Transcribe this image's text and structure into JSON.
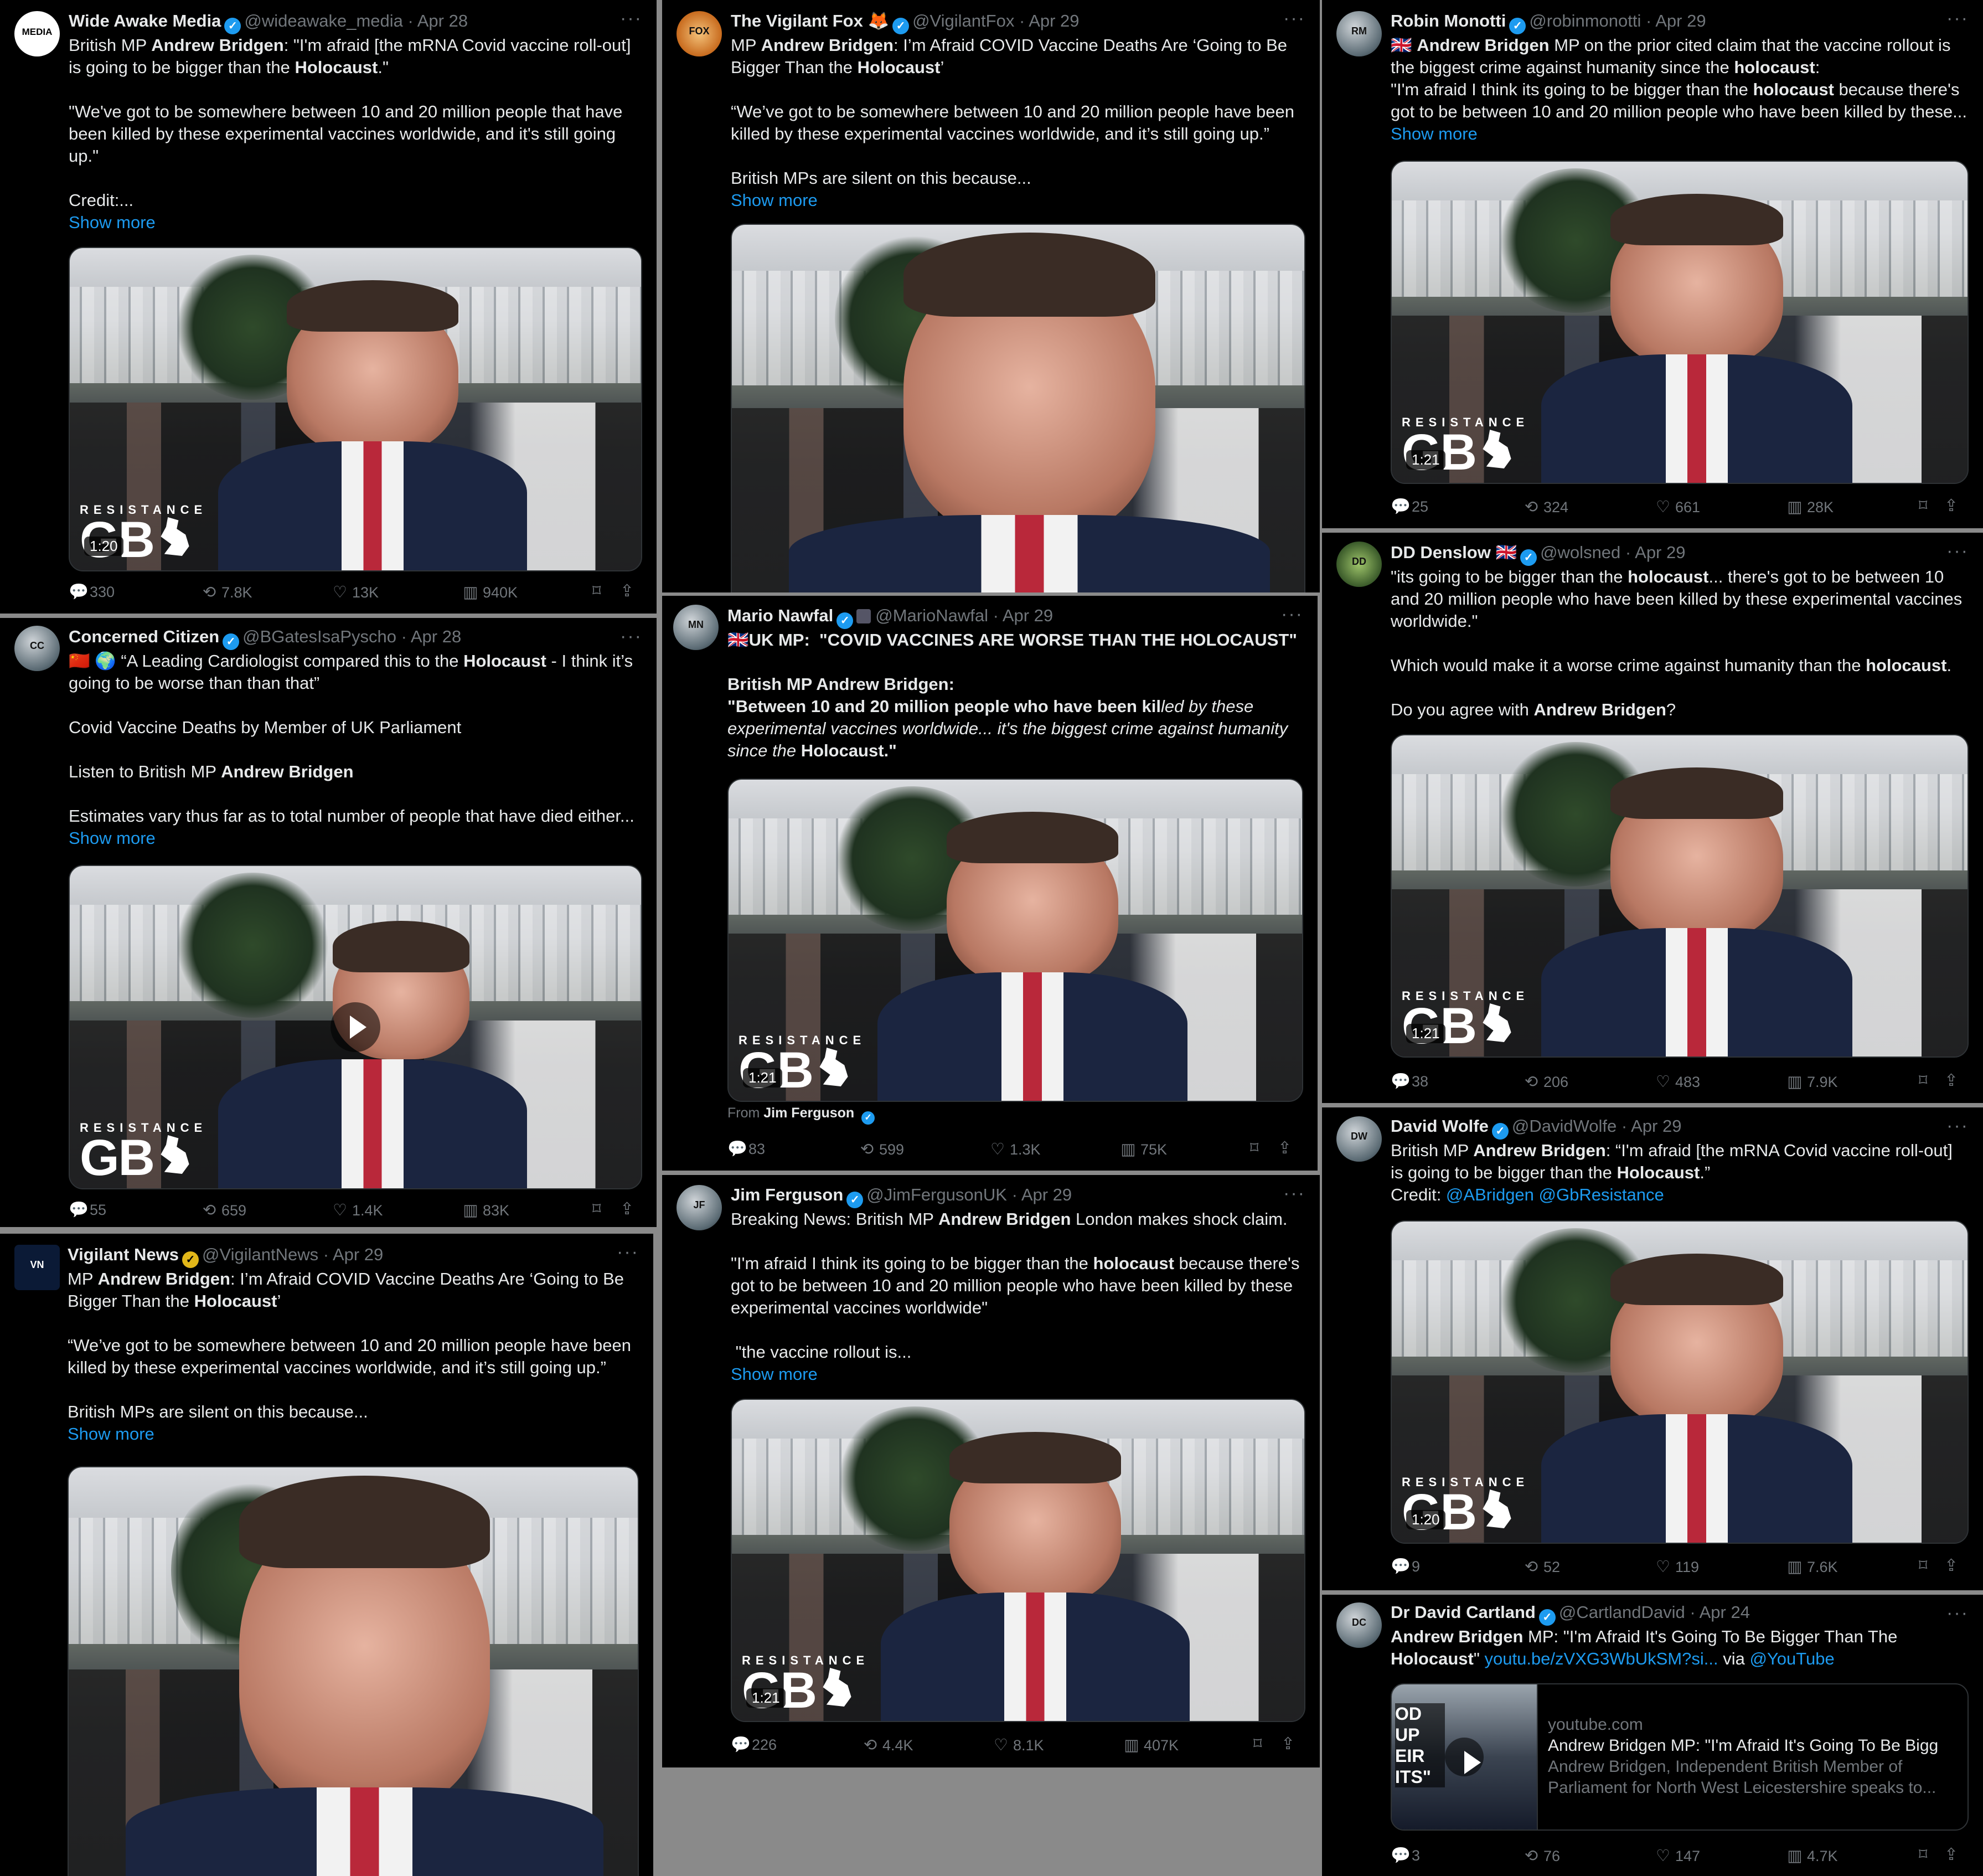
{
  "tweets": [
    {
      "name": "Wide Awake Media",
      "handle": "@wideawake_media",
      "date": "Apr 28",
      "avatar": "MEDIA",
      "text": [
        [
          {
            "t": "British MP "
          },
          {
            "t": "Andrew Bridgen",
            "b": true
          },
          {
            "t": ": \"I'm afraid [the mRNA Covid vaccine roll-out] is going to be bigger than the "
          },
          {
            "t": "Holocaust",
            "b": true
          },
          {
            "t": ".\""
          }
        ],
        [
          {
            "t": " "
          }
        ],
        [
          {
            "t": "\"We've got to be somewhere between 10 and 20 million people that have been killed by these experimental vaccines worldwide, and it's still going up.\""
          }
        ],
        [
          {
            "t": " "
          }
        ],
        [
          {
            "t": "Credit:..."
          }
        ]
      ],
      "show_more": "Show more",
      "duration": "1:20",
      "watermark": "RESISTANCE",
      "watermark_big": "GB",
      "replies": "330",
      "reposts": "7.8K",
      "likes": "13K",
      "views": "940K"
    },
    {
      "name": "The Vigilant Fox",
      "handle": "@VigilantFox",
      "date": "Apr 29",
      "avatar": "FOX",
      "text": [
        [
          {
            "t": "MP "
          },
          {
            "t": "Andrew Bridgen",
            "b": true
          },
          {
            "t": ": I’m Afraid COVID Vaccine Deaths Are ‘Going to Be Bigger Than the "
          },
          {
            "t": "Holocaust",
            "b": true
          },
          {
            "t": "’"
          }
        ],
        [
          {
            "t": " "
          }
        ],
        [
          {
            "t": "“We’ve got to be somewhere between 10 and 20 million people have been killed by these experimental vaccines worldwide, and it’s still going up.”"
          }
        ],
        [
          {
            "t": " "
          }
        ],
        [
          {
            "t": "British MPs are silent on this because..."
          }
        ]
      ],
      "show_more": "Show more"
    },
    {
      "name": "Robin Monotti",
      "handle": "@robinmonotti",
      "date": "Apr 29",
      "avatar": "RM",
      "text": [
        [
          {
            "t": "🇬🇧 "
          },
          {
            "t": "Andrew Bridgen",
            "b": true
          },
          {
            "t": " MP on the prior cited claim that the vaccine rollout is the biggest crime against humanity since the "
          },
          {
            "t": "holocaust",
            "b": true
          },
          {
            "t": ":"
          }
        ],
        [
          {
            "t": "\"I'm afraid I think its going to be bigger than the "
          },
          {
            "t": "holocaust",
            "b": true
          },
          {
            "t": " because there's got to be between 10 and 20 million people who have been killed by these..."
          }
        ]
      ],
      "show_more": "Show more",
      "duration": "1:21",
      "watermark": "RESISTANCE",
      "watermark_big": "GB",
      "replies": "25",
      "reposts": "324",
      "likes": "661",
      "views": "28K"
    },
    {
      "name": "Concerned Citizen",
      "handle": "@BGatesIsaPyscho",
      "date": "Apr 28",
      "avatar": "CC",
      "text": [
        [
          {
            "t": "🇨🇳 🌍 “A Leading Cardiologist compared this to the "
          },
          {
            "t": "Holocaust",
            "b": true
          },
          {
            "t": " - I think it’s going to be worse than than that”"
          }
        ],
        [
          {
            "t": " "
          }
        ],
        [
          {
            "t": "Covid Vaccine Deaths by Member of UK Parliament"
          }
        ],
        [
          {
            "t": " "
          }
        ],
        [
          {
            "t": "Listen to British MP "
          },
          {
            "t": "Andrew Bridgen",
            "b": true
          }
        ],
        [
          {
            "t": " "
          }
        ],
        [
          {
            "t": "Estimates vary thus far as to total number of people that have died either..."
          }
        ]
      ],
      "show_more": "Show more",
      "watermark": "RESISTANCE",
      "watermark_big": "GB",
      "replies": "55",
      "reposts": "659",
      "likes": "1.4K",
      "views": "83K"
    },
    {
      "name": "Mario Nawfal",
      "handle": "@MarioNawfal",
      "date": "Apr 29",
      "avatar": "MN",
      "text": [
        [
          {
            "t": "🇬🇧UK MP:  \"COVID VACCINES ARE WORSE THAN THE HOLOCAUST\"",
            "b": true
          }
        ],
        [
          {
            "t": " "
          }
        ],
        [
          {
            "t": "British MP Andrew Bridgen:",
            "b": true
          }
        ],
        [
          {
            "t": "\"Between 10 and 20 million people who have been kil",
            "b": true
          },
          {
            "t": "led by these experimental vaccines worldwide... it's the biggest crime against humanity since the "
          },
          {
            "t": "Holocaust.\"",
            "b": true
          }
        ]
      ],
      "duration": "1:21",
      "watermark": "RESISTANCE",
      "watermark_big": "GB",
      "from_label": "From",
      "from_name": "Jim Ferguson",
      "replies": "83",
      "reposts": "599",
      "likes": "1.3K",
      "views": "75K"
    },
    {
      "name": "DD Denslow 🇬🇧",
      "handle": "@wolsned",
      "date": "Apr 29",
      "avatar": "DD",
      "text": [
        [
          {
            "t": "\"its going to be bigger than the "
          },
          {
            "t": "holocaust",
            "b": true
          },
          {
            "t": "... there's got to be between 10 and 20 million people who have been killed by these experimental vaccines worldwide.\""
          }
        ],
        [
          {
            "t": " "
          }
        ],
        [
          {
            "t": "Which would make it a worse crime against humanity than the "
          },
          {
            "t": "holocaust",
            "b": true
          },
          {
            "t": "."
          }
        ],
        [
          {
            "t": " "
          }
        ],
        [
          {
            "t": "Do you agree with "
          },
          {
            "t": "Andrew Bridgen",
            "b": true
          },
          {
            "t": "?"
          }
        ]
      ],
      "duration": "1:21",
      "watermark": "RESISTANCE",
      "watermark_big": "GB",
      "replies": "38",
      "reposts": "206",
      "likes": "483",
      "views": "7.9K"
    },
    {
      "name": "Vigilant News",
      "handle": "@VigilantNews",
      "date": "Apr 29",
      "avatar": "VN",
      "text": [
        [
          {
            "t": "MP "
          },
          {
            "t": "Andrew Bridgen",
            "b": true
          },
          {
            "t": ": I’m Afraid COVID Vaccine Deaths Are ‘Going to Be Bigger Than the "
          },
          {
            "t": "Holocaust",
            "b": true
          },
          {
            "t": "’"
          }
        ],
        [
          {
            "t": " "
          }
        ],
        [
          {
            "t": "“We’ve got to be somewhere between 10 and 20 million people have been killed by these experimental vaccines worldwide, and it’s still going up.”"
          }
        ],
        [
          {
            "t": " "
          }
        ],
        [
          {
            "t": "British MPs are silent on this because..."
          }
        ]
      ],
      "show_more": "Show more"
    },
    {
      "name": "Jim Ferguson",
      "handle": "@JimFergusonUK",
      "date": "Apr 29",
      "avatar": "JF",
      "text": [
        [
          {
            "t": "Breaking News: British MP "
          },
          {
            "t": "Andrew Bridgen",
            "b": true
          },
          {
            "t": " London makes shock claim."
          }
        ],
        [
          {
            "t": " "
          }
        ],
        [
          {
            "t": "\"I'm afraid I think its going to be bigger than the "
          },
          {
            "t": "holocaust",
            "b": true
          },
          {
            "t": " because there's got to be between 10 and 20 million people who have been killed by these experimental vaccines worldwide\""
          }
        ],
        [
          {
            "t": " "
          }
        ],
        [
          {
            "t": " \"the vaccine rollout is..."
          }
        ]
      ],
      "show_more": "Show more",
      "duration": "1:21",
      "watermark": "RESISTANCE",
      "watermark_big": "GB",
      "replies": "226",
      "reposts": "4.4K",
      "likes": "8.1K",
      "views": "407K"
    },
    {
      "name": "David Wolfe",
      "handle": "@DavidWolfe",
      "date": "Apr 29",
      "avatar": "DW",
      "text": [
        [
          {
            "t": "British MP "
          },
          {
            "t": "Andrew Bridgen",
            "b": true
          },
          {
            "t": ": “I'm afraid [the mRNA Covid vaccine roll-out] is going to be bigger than the "
          },
          {
            "t": "Holocaust",
            "b": true
          },
          {
            "t": ".”"
          }
        ],
        [
          {
            "t": "Credit: "
          },
          {
            "t": "@ABridgen @GbResistance",
            "l": true
          }
        ]
      ],
      "duration": "1:20",
      "watermark": "RESISTANCE",
      "watermark_big": "GB",
      "replies": "9",
      "reposts": "52",
      "likes": "119",
      "views": "7.6K"
    },
    {
      "name": "Dr David Cartland",
      "handle": "@CartlandDavid",
      "date": "Apr 24",
      "avatar": "DC",
      "text": [
        [
          {
            "t": "Andrew Bridgen",
            "b": true
          },
          {
            "t": " MP: \"I'm Afraid It's Going To Be Bigger Than The "
          },
          {
            "t": "Holocaust",
            "b": true
          },
          {
            "t": "\" "
          },
          {
            "t": "youtu.be/zVXG3WbUkSM?si...",
            "l": true
          },
          {
            "t": " via "
          },
          {
            "t": "@YouTube",
            "l": true
          }
        ]
      ],
      "card_domain": "youtube.com",
      "card_title": "Andrew Bridgen MP: \"I'm Afraid It's Going To Be Bigg",
      "card_desc": "Andrew Bridgen, Independent British Member of Parliament for North West Leicestershire speaks to...",
      "card_thumb_text": "OD UP EIR ITS\"",
      "replies": "3",
      "reposts": "76",
      "likes": "147",
      "views": "4.7K"
    }
  ]
}
